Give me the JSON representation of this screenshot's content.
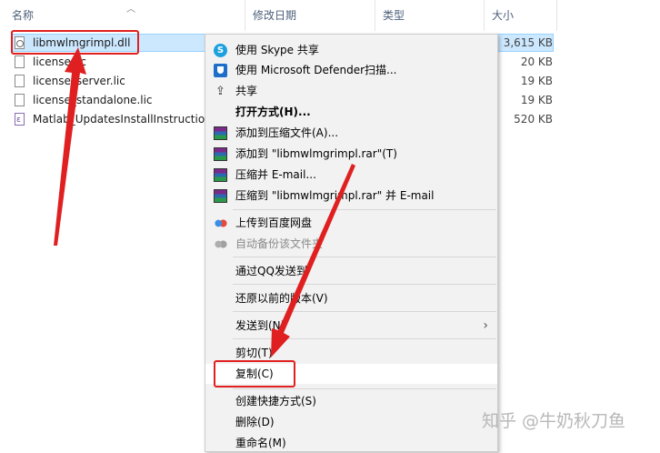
{
  "columns": {
    "name": "名称",
    "date": "修改日期",
    "type": "类型",
    "size": "大小"
  },
  "files": [
    {
      "name": "libmwlmgrimpl.dll",
      "size": "3,615 KB",
      "icon": "dll-file-icon"
    },
    {
      "name": "license.lic",
      "size": "20 KB",
      "icon": "document-icon"
    },
    {
      "name": "license_server.lic",
      "size": "19 KB",
      "icon": "document-icon"
    },
    {
      "name": "license_standalone.lic",
      "size": "19 KB",
      "icon": "document-icon"
    },
    {
      "name": "Matlab_UpdatesInstallInstructions",
      "size": "520 KB",
      "icon": "pdf-file-icon"
    }
  ],
  "menu": {
    "items": [
      {
        "label": "使用 Skype 共享",
        "icon": "skype-icon"
      },
      {
        "label": "使用 Microsoft Defender扫描...",
        "icon": "defender-shield-icon"
      },
      {
        "label": "共享",
        "icon": "share-icon"
      },
      {
        "label": "打开方式(H)...",
        "bold": true
      },
      {
        "label": "添加到压缩文件(A)...",
        "icon": "winrar-icon"
      },
      {
        "label": "添加到 \"libmwlmgrimpl.rar\"(T)",
        "icon": "winrar-icon"
      },
      {
        "label": "压缩并 E-mail...",
        "icon": "winrar-icon"
      },
      {
        "label": "压缩到 \"libmwlmgrimpl.rar\" 并 E-mail",
        "icon": "winrar-icon"
      },
      {
        "label": "上传到百度网盘",
        "icon": "baidu-cloud-icon"
      },
      {
        "label": "自动备份该文件夹",
        "icon": "baidu-cloud-icon",
        "disabled": true
      },
      {
        "label": "通过QQ发送到"
      },
      {
        "label": "还原以前的版本(V)"
      },
      {
        "label": "发送到(N)",
        "submenu": true
      },
      {
        "label": "剪切(T)"
      },
      {
        "label": "复制(C)",
        "highlighted": true
      },
      {
        "label": "创建快捷方式(S)"
      },
      {
        "label": "删除(D)"
      },
      {
        "label": "重命名(M)"
      }
    ],
    "submenu_glyph": "›"
  },
  "annotation_color": "#e02020",
  "watermark": "知乎 @牛奶秋刀鱼"
}
